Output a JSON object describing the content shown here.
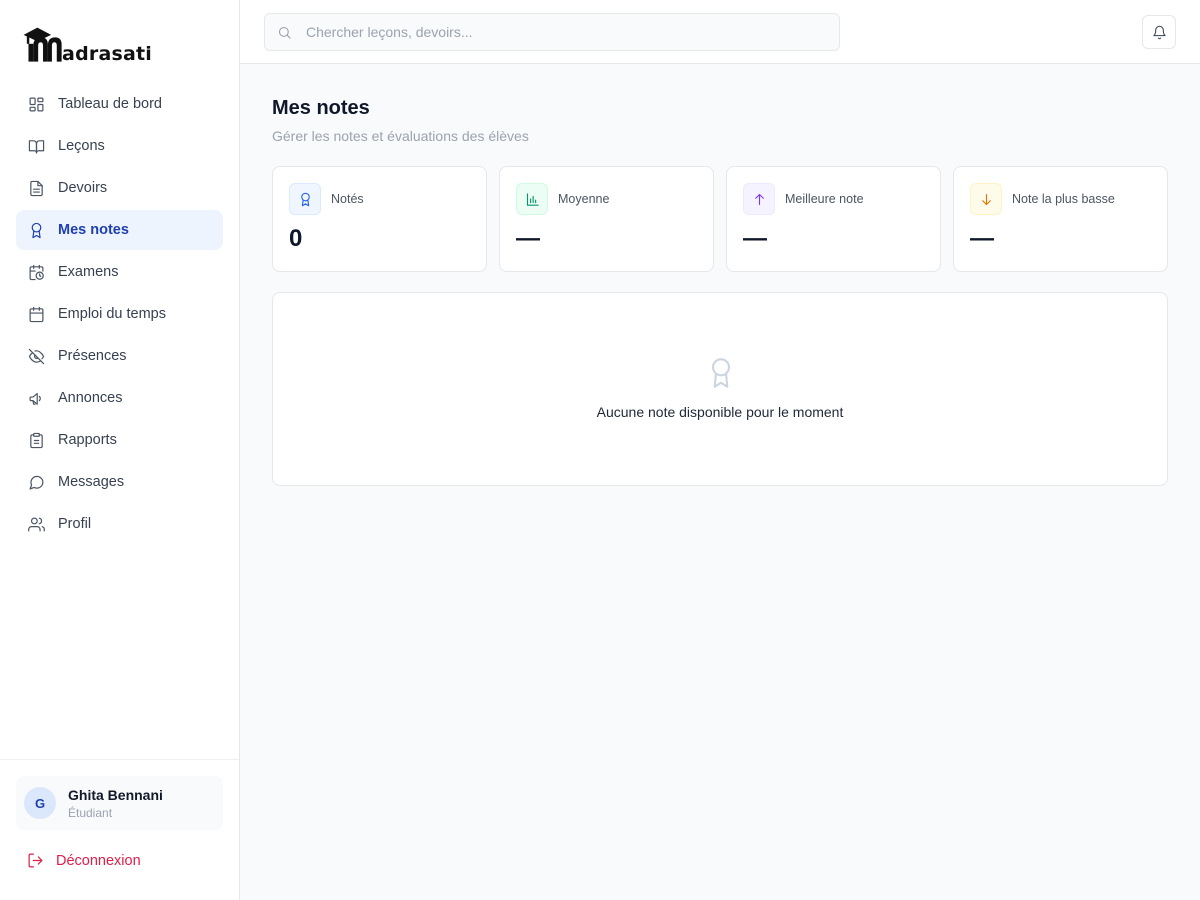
{
  "brand": {
    "logo_text": "adrasati"
  },
  "sidebar": {
    "items": [
      {
        "label": "Tableau de bord",
        "icon": "dashboard-grid-icon"
      },
      {
        "label": "Leçons",
        "icon": "book-icon"
      },
      {
        "label": "Devoirs",
        "icon": "document-icon"
      },
      {
        "label": "Mes notes",
        "icon": "award-icon",
        "active": true
      },
      {
        "label": "Examens",
        "icon": "calendar-clock-icon"
      },
      {
        "label": "Emploi du temps",
        "icon": "calendar-icon"
      },
      {
        "label": "Présences",
        "icon": "eye-off-icon"
      },
      {
        "label": "Annonces",
        "icon": "megaphone-icon"
      },
      {
        "label": "Rapports",
        "icon": "clipboard-icon"
      },
      {
        "label": "Messages",
        "icon": "message-circle-icon"
      },
      {
        "label": "Profil",
        "icon": "users-icon"
      }
    ],
    "user": {
      "initial": "G",
      "name": "Ghita Bennani",
      "role": "Étudiant"
    },
    "logout_label": "Déconnexion"
  },
  "header": {
    "search_placeholder": "Chercher leçons, devoirs...",
    "search_value": ""
  },
  "page": {
    "title": "Mes notes",
    "subtitle": "Gérer les notes et évaluations des élèves"
  },
  "stats": [
    {
      "label": "Notés",
      "value": "0",
      "icon": "award-icon",
      "color": "#2563eb",
      "bg": "#eff6ff",
      "border": "#dbeafe"
    },
    {
      "label": "Moyenne",
      "value": "—",
      "icon": "bar-chart-icon",
      "color": "#059669",
      "bg": "#ecfdf5",
      "border": "#d1fae5"
    },
    {
      "label": "Meilleure note",
      "value": "—",
      "icon": "arrow-up-icon",
      "color": "#7c3aed",
      "bg": "#f5f3ff",
      "border": "#ede9fe"
    },
    {
      "label": "Note la plus basse",
      "value": "—",
      "icon": "arrow-down-icon",
      "color": "#d97706",
      "bg": "#fffbeb",
      "border": "#fef3c7"
    }
  ],
  "empty_state": {
    "icon": "award-icon",
    "message": "Aucune note disponible pour le moment"
  }
}
